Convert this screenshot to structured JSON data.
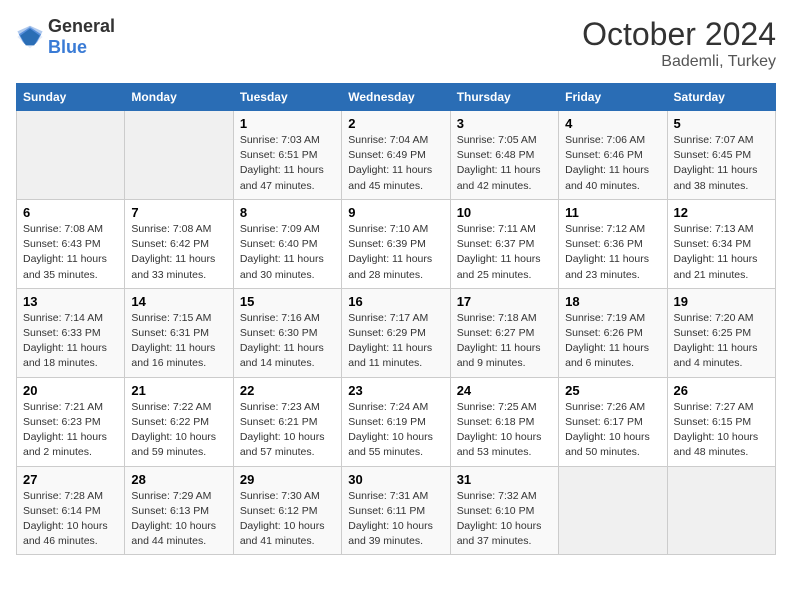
{
  "header": {
    "logo_general": "General",
    "logo_blue": "Blue",
    "month": "October 2024",
    "location": "Bademli, Turkey"
  },
  "weekdays": [
    "Sunday",
    "Monday",
    "Tuesday",
    "Wednesday",
    "Thursday",
    "Friday",
    "Saturday"
  ],
  "weeks": [
    [
      {
        "day": "",
        "empty": true
      },
      {
        "day": "",
        "empty": true
      },
      {
        "day": "1",
        "sunrise": "7:03 AM",
        "sunset": "6:51 PM",
        "daylight": "11 hours and 47 minutes."
      },
      {
        "day": "2",
        "sunrise": "7:04 AM",
        "sunset": "6:49 PM",
        "daylight": "11 hours and 45 minutes."
      },
      {
        "day": "3",
        "sunrise": "7:05 AM",
        "sunset": "6:48 PM",
        "daylight": "11 hours and 42 minutes."
      },
      {
        "day": "4",
        "sunrise": "7:06 AM",
        "sunset": "6:46 PM",
        "daylight": "11 hours and 40 minutes."
      },
      {
        "day": "5",
        "sunrise": "7:07 AM",
        "sunset": "6:45 PM",
        "daylight": "11 hours and 38 minutes."
      }
    ],
    [
      {
        "day": "6",
        "sunrise": "7:08 AM",
        "sunset": "6:43 PM",
        "daylight": "11 hours and 35 minutes."
      },
      {
        "day": "7",
        "sunrise": "7:08 AM",
        "sunset": "6:42 PM",
        "daylight": "11 hours and 33 minutes."
      },
      {
        "day": "8",
        "sunrise": "7:09 AM",
        "sunset": "6:40 PM",
        "daylight": "11 hours and 30 minutes."
      },
      {
        "day": "9",
        "sunrise": "7:10 AM",
        "sunset": "6:39 PM",
        "daylight": "11 hours and 28 minutes."
      },
      {
        "day": "10",
        "sunrise": "7:11 AM",
        "sunset": "6:37 PM",
        "daylight": "11 hours and 25 minutes."
      },
      {
        "day": "11",
        "sunrise": "7:12 AM",
        "sunset": "6:36 PM",
        "daylight": "11 hours and 23 minutes."
      },
      {
        "day": "12",
        "sunrise": "7:13 AM",
        "sunset": "6:34 PM",
        "daylight": "11 hours and 21 minutes."
      }
    ],
    [
      {
        "day": "13",
        "sunrise": "7:14 AM",
        "sunset": "6:33 PM",
        "daylight": "11 hours and 18 minutes."
      },
      {
        "day": "14",
        "sunrise": "7:15 AM",
        "sunset": "6:31 PM",
        "daylight": "11 hours and 16 minutes."
      },
      {
        "day": "15",
        "sunrise": "7:16 AM",
        "sunset": "6:30 PM",
        "daylight": "11 hours and 14 minutes."
      },
      {
        "day": "16",
        "sunrise": "7:17 AM",
        "sunset": "6:29 PM",
        "daylight": "11 hours and 11 minutes."
      },
      {
        "day": "17",
        "sunrise": "7:18 AM",
        "sunset": "6:27 PM",
        "daylight": "11 hours and 9 minutes."
      },
      {
        "day": "18",
        "sunrise": "7:19 AM",
        "sunset": "6:26 PM",
        "daylight": "11 hours and 6 minutes."
      },
      {
        "day": "19",
        "sunrise": "7:20 AM",
        "sunset": "6:25 PM",
        "daylight": "11 hours and 4 minutes."
      }
    ],
    [
      {
        "day": "20",
        "sunrise": "7:21 AM",
        "sunset": "6:23 PM",
        "daylight": "11 hours and 2 minutes."
      },
      {
        "day": "21",
        "sunrise": "7:22 AM",
        "sunset": "6:22 PM",
        "daylight": "10 hours and 59 minutes."
      },
      {
        "day": "22",
        "sunrise": "7:23 AM",
        "sunset": "6:21 PM",
        "daylight": "10 hours and 57 minutes."
      },
      {
        "day": "23",
        "sunrise": "7:24 AM",
        "sunset": "6:19 PM",
        "daylight": "10 hours and 55 minutes."
      },
      {
        "day": "24",
        "sunrise": "7:25 AM",
        "sunset": "6:18 PM",
        "daylight": "10 hours and 53 minutes."
      },
      {
        "day": "25",
        "sunrise": "7:26 AM",
        "sunset": "6:17 PM",
        "daylight": "10 hours and 50 minutes."
      },
      {
        "day": "26",
        "sunrise": "7:27 AM",
        "sunset": "6:15 PM",
        "daylight": "10 hours and 48 minutes."
      }
    ],
    [
      {
        "day": "27",
        "sunrise": "7:28 AM",
        "sunset": "6:14 PM",
        "daylight": "10 hours and 46 minutes."
      },
      {
        "day": "28",
        "sunrise": "7:29 AM",
        "sunset": "6:13 PM",
        "daylight": "10 hours and 44 minutes."
      },
      {
        "day": "29",
        "sunrise": "7:30 AM",
        "sunset": "6:12 PM",
        "daylight": "10 hours and 41 minutes."
      },
      {
        "day": "30",
        "sunrise": "7:31 AM",
        "sunset": "6:11 PM",
        "daylight": "10 hours and 39 minutes."
      },
      {
        "day": "31",
        "sunrise": "7:32 AM",
        "sunset": "6:10 PM",
        "daylight": "10 hours and 37 minutes."
      },
      {
        "day": "",
        "empty": true
      },
      {
        "day": "",
        "empty": true
      }
    ]
  ]
}
